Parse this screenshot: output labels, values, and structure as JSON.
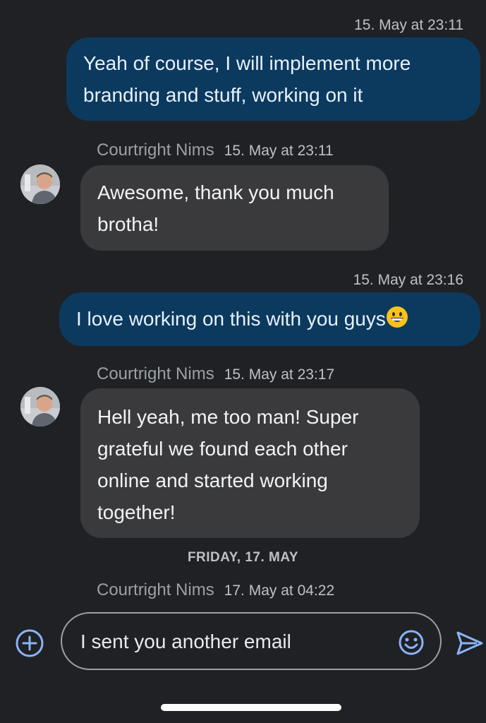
{
  "messages": [
    {
      "timestamp": "15. May at 23:11",
      "text_lines": [
        "Yeah of course, I will implement more",
        "branding and stuff, working on it"
      ]
    },
    {
      "sender": "Courtright Nims",
      "timestamp": "15. May at 23:11",
      "text_lines": [
        "Awesome, thank you much",
        "brotha!"
      ]
    },
    {
      "timestamp": "15. May at 23:16",
      "text": "I love working on this with you guys",
      "emoji": "grinning-face-emoji"
    },
    {
      "sender": "Courtright Nims",
      "timestamp": "15. May at 23:17",
      "text_lines": [
        "Hell yeah, me too man!  Super",
        "grateful we found each other",
        "online and started working",
        "together!"
      ]
    },
    {
      "date_separator": "FRIDAY, 17. MAY"
    },
    {
      "sender": "Courtright Nims",
      "timestamp": "17. May at 04:22"
    }
  ],
  "composer": {
    "value": "I sent you another email",
    "icons": [
      "add-circle-icon",
      "emoji-icon",
      "send-icon"
    ]
  },
  "colors": {
    "background": "#202124",
    "outgoing_bubble": "#0b3a5e",
    "incoming_bubble": "#3a3a3c",
    "accent": "#8ab4f8"
  }
}
